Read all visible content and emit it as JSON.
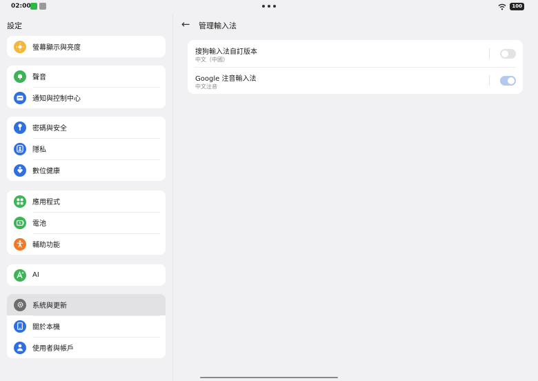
{
  "status_bar": {
    "time": "02:00",
    "battery": "100"
  },
  "sidebar": {
    "title": "設定",
    "groups": [
      {
        "items": [
          {
            "label": "螢幕顯示與亮度",
            "icon": "sun-icon",
            "color": "#f5b63b"
          }
        ]
      },
      {
        "items": [
          {
            "label": "聲音",
            "icon": "bell-icon",
            "color": "#3cb556"
          },
          {
            "label": "通知與控制中心",
            "icon": "notification-icon",
            "color": "#2f6fe0"
          }
        ]
      },
      {
        "items": [
          {
            "label": "密碼與安全",
            "icon": "key-icon",
            "color": "#2f6fe0"
          },
          {
            "label": "隱私",
            "icon": "privacy-icon",
            "color": "#2f6fe0"
          },
          {
            "label": "數位健康",
            "icon": "wellbeing-icon",
            "color": "#2f6fe0"
          }
        ]
      },
      {
        "items": [
          {
            "label": "應用程式",
            "icon": "apps-icon",
            "color": "#3cb556"
          },
          {
            "label": "電池",
            "icon": "battery-icon",
            "color": "#3cb556"
          },
          {
            "label": "輔助功能",
            "icon": "accessibility-icon",
            "color": "#f07a2a"
          }
        ]
      },
      {
        "items": [
          {
            "label": "AI",
            "icon": "ai-icon",
            "color": "#3cb556"
          }
        ]
      },
      {
        "items": [
          {
            "label": "系統與更新",
            "icon": "gear-icon",
            "color": "#6d6d6d",
            "selected": true
          },
          {
            "label": "關於本機",
            "icon": "phone-icon",
            "color": "#2f6fe0"
          },
          {
            "label": "使用者與帳戶",
            "icon": "user-icon",
            "color": "#2f6fe0"
          }
        ]
      }
    ]
  },
  "main": {
    "title": "管理輸入法",
    "keyboards": [
      {
        "title": "搜狗輸入法自訂版本",
        "subtitle": "中文（中國）",
        "enabled": false
      },
      {
        "title": "Google 注音輸入法",
        "subtitle": "中文注音",
        "enabled": true
      }
    ]
  }
}
